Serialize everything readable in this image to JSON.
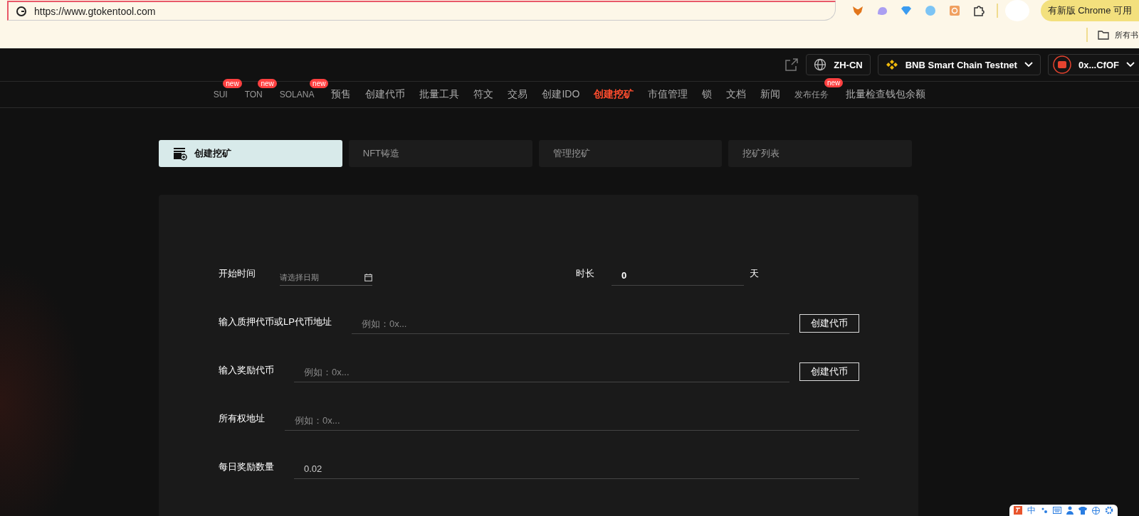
{
  "browser": {
    "url": "https://www.gtokentool.com",
    "update_button": "有新版 Chrome 可用",
    "bookmarks_label": "所有书"
  },
  "header": {
    "language": "ZH-CN",
    "network": "BNB Smart Chain Testnet",
    "wallet": "0x...CfOF"
  },
  "nav": [
    {
      "label": "SUI",
      "badge": "new",
      "selected": false
    },
    {
      "label": "TON",
      "badge": "new",
      "selected": false
    },
    {
      "label": "SOLANA",
      "badge": "new",
      "selected": false
    },
    {
      "label": "预售",
      "selected": false
    },
    {
      "label": "创建代币",
      "selected": false
    },
    {
      "label": "批量工具",
      "selected": false
    },
    {
      "label": "符文",
      "selected": false
    },
    {
      "label": "交易",
      "selected": false
    },
    {
      "label": "创建IDO",
      "selected": false
    },
    {
      "label": "创建挖矿",
      "selected": true
    },
    {
      "label": "市值管理",
      "selected": false
    },
    {
      "label": "锁",
      "selected": false
    },
    {
      "label": "文档",
      "selected": false
    },
    {
      "label": "新闻",
      "selected": false
    },
    {
      "label": "发布任务",
      "badge": "new",
      "selected": false
    },
    {
      "label": "批量检查钱包余额",
      "selected": false
    }
  ],
  "tabs": [
    {
      "label": "创建挖矿",
      "selected": true
    },
    {
      "label": "NFT铸造",
      "selected": false
    },
    {
      "label": "管理挖矿",
      "selected": false
    },
    {
      "label": "挖矿列表",
      "selected": false
    }
  ],
  "schedule": {
    "start_label": "开始时间",
    "start_placeholder": "请选择日期",
    "duration_label": "时长",
    "duration_value": "0",
    "duration_unit": "天"
  },
  "fields": [
    {
      "label": "输入质押代币或LP代币地址",
      "placeholder": "例如：0x...",
      "button": "创建代币"
    },
    {
      "label": "输入奖励代币",
      "placeholder": "例如：0x...",
      "button": "创建代币"
    },
    {
      "label": "所有权地址",
      "placeholder": "例如：0x..."
    },
    {
      "label": "每日奖励数量",
      "value": "0.02"
    }
  ],
  "ime_toolbar": {
    "mode": "中"
  }
}
